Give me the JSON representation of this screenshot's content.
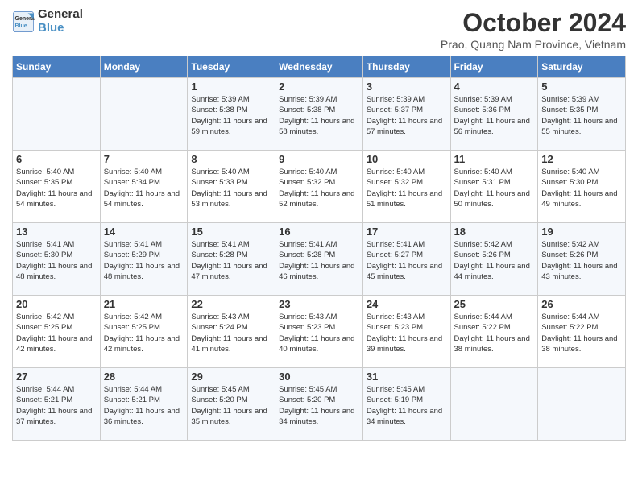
{
  "header": {
    "logo_line1": "General",
    "logo_line2": "Blue",
    "month": "October 2024",
    "location": "Prao, Quang Nam Province, Vietnam"
  },
  "weekdays": [
    "Sunday",
    "Monday",
    "Tuesday",
    "Wednesday",
    "Thursday",
    "Friday",
    "Saturday"
  ],
  "weeks": [
    [
      {
        "day": "",
        "sunrise": "",
        "sunset": "",
        "daylight": ""
      },
      {
        "day": "",
        "sunrise": "",
        "sunset": "",
        "daylight": ""
      },
      {
        "day": "1",
        "sunrise": "Sunrise: 5:39 AM",
        "sunset": "Sunset: 5:38 PM",
        "daylight": "Daylight: 11 hours and 59 minutes."
      },
      {
        "day": "2",
        "sunrise": "Sunrise: 5:39 AM",
        "sunset": "Sunset: 5:38 PM",
        "daylight": "Daylight: 11 hours and 58 minutes."
      },
      {
        "day": "3",
        "sunrise": "Sunrise: 5:39 AM",
        "sunset": "Sunset: 5:37 PM",
        "daylight": "Daylight: 11 hours and 57 minutes."
      },
      {
        "day": "4",
        "sunrise": "Sunrise: 5:39 AM",
        "sunset": "Sunset: 5:36 PM",
        "daylight": "Daylight: 11 hours and 56 minutes."
      },
      {
        "day": "5",
        "sunrise": "Sunrise: 5:39 AM",
        "sunset": "Sunset: 5:35 PM",
        "daylight": "Daylight: 11 hours and 55 minutes."
      }
    ],
    [
      {
        "day": "6",
        "sunrise": "Sunrise: 5:40 AM",
        "sunset": "Sunset: 5:35 PM",
        "daylight": "Daylight: 11 hours and 54 minutes."
      },
      {
        "day": "7",
        "sunrise": "Sunrise: 5:40 AM",
        "sunset": "Sunset: 5:34 PM",
        "daylight": "Daylight: 11 hours and 54 minutes."
      },
      {
        "day": "8",
        "sunrise": "Sunrise: 5:40 AM",
        "sunset": "Sunset: 5:33 PM",
        "daylight": "Daylight: 11 hours and 53 minutes."
      },
      {
        "day": "9",
        "sunrise": "Sunrise: 5:40 AM",
        "sunset": "Sunset: 5:32 PM",
        "daylight": "Daylight: 11 hours and 52 minutes."
      },
      {
        "day": "10",
        "sunrise": "Sunrise: 5:40 AM",
        "sunset": "Sunset: 5:32 PM",
        "daylight": "Daylight: 11 hours and 51 minutes."
      },
      {
        "day": "11",
        "sunrise": "Sunrise: 5:40 AM",
        "sunset": "Sunset: 5:31 PM",
        "daylight": "Daylight: 11 hours and 50 minutes."
      },
      {
        "day": "12",
        "sunrise": "Sunrise: 5:40 AM",
        "sunset": "Sunset: 5:30 PM",
        "daylight": "Daylight: 11 hours and 49 minutes."
      }
    ],
    [
      {
        "day": "13",
        "sunrise": "Sunrise: 5:41 AM",
        "sunset": "Sunset: 5:30 PM",
        "daylight": "Daylight: 11 hours and 48 minutes."
      },
      {
        "day": "14",
        "sunrise": "Sunrise: 5:41 AM",
        "sunset": "Sunset: 5:29 PM",
        "daylight": "Daylight: 11 hours and 48 minutes."
      },
      {
        "day": "15",
        "sunrise": "Sunrise: 5:41 AM",
        "sunset": "Sunset: 5:28 PM",
        "daylight": "Daylight: 11 hours and 47 minutes."
      },
      {
        "day": "16",
        "sunrise": "Sunrise: 5:41 AM",
        "sunset": "Sunset: 5:28 PM",
        "daylight": "Daylight: 11 hours and 46 minutes."
      },
      {
        "day": "17",
        "sunrise": "Sunrise: 5:41 AM",
        "sunset": "Sunset: 5:27 PM",
        "daylight": "Daylight: 11 hours and 45 minutes."
      },
      {
        "day": "18",
        "sunrise": "Sunrise: 5:42 AM",
        "sunset": "Sunset: 5:26 PM",
        "daylight": "Daylight: 11 hours and 44 minutes."
      },
      {
        "day": "19",
        "sunrise": "Sunrise: 5:42 AM",
        "sunset": "Sunset: 5:26 PM",
        "daylight": "Daylight: 11 hours and 43 minutes."
      }
    ],
    [
      {
        "day": "20",
        "sunrise": "Sunrise: 5:42 AM",
        "sunset": "Sunset: 5:25 PM",
        "daylight": "Daylight: 11 hours and 42 minutes."
      },
      {
        "day": "21",
        "sunrise": "Sunrise: 5:42 AM",
        "sunset": "Sunset: 5:25 PM",
        "daylight": "Daylight: 11 hours and 42 minutes."
      },
      {
        "day": "22",
        "sunrise": "Sunrise: 5:43 AM",
        "sunset": "Sunset: 5:24 PM",
        "daylight": "Daylight: 11 hours and 41 minutes."
      },
      {
        "day": "23",
        "sunrise": "Sunrise: 5:43 AM",
        "sunset": "Sunset: 5:23 PM",
        "daylight": "Daylight: 11 hours and 40 minutes."
      },
      {
        "day": "24",
        "sunrise": "Sunrise: 5:43 AM",
        "sunset": "Sunset: 5:23 PM",
        "daylight": "Daylight: 11 hours and 39 minutes."
      },
      {
        "day": "25",
        "sunrise": "Sunrise: 5:44 AM",
        "sunset": "Sunset: 5:22 PM",
        "daylight": "Daylight: 11 hours and 38 minutes."
      },
      {
        "day": "26",
        "sunrise": "Sunrise: 5:44 AM",
        "sunset": "Sunset: 5:22 PM",
        "daylight": "Daylight: 11 hours and 38 minutes."
      }
    ],
    [
      {
        "day": "27",
        "sunrise": "Sunrise: 5:44 AM",
        "sunset": "Sunset: 5:21 PM",
        "daylight": "Daylight: 11 hours and 37 minutes."
      },
      {
        "day": "28",
        "sunrise": "Sunrise: 5:44 AM",
        "sunset": "Sunset: 5:21 PM",
        "daylight": "Daylight: 11 hours and 36 minutes."
      },
      {
        "day": "29",
        "sunrise": "Sunrise: 5:45 AM",
        "sunset": "Sunset: 5:20 PM",
        "daylight": "Daylight: 11 hours and 35 minutes."
      },
      {
        "day": "30",
        "sunrise": "Sunrise: 5:45 AM",
        "sunset": "Sunset: 5:20 PM",
        "daylight": "Daylight: 11 hours and 34 minutes."
      },
      {
        "day": "31",
        "sunrise": "Sunrise: 5:45 AM",
        "sunset": "Sunset: 5:19 PM",
        "daylight": "Daylight: 11 hours and 34 minutes."
      },
      {
        "day": "",
        "sunrise": "",
        "sunset": "",
        "daylight": ""
      },
      {
        "day": "",
        "sunrise": "",
        "sunset": "",
        "daylight": ""
      }
    ]
  ]
}
